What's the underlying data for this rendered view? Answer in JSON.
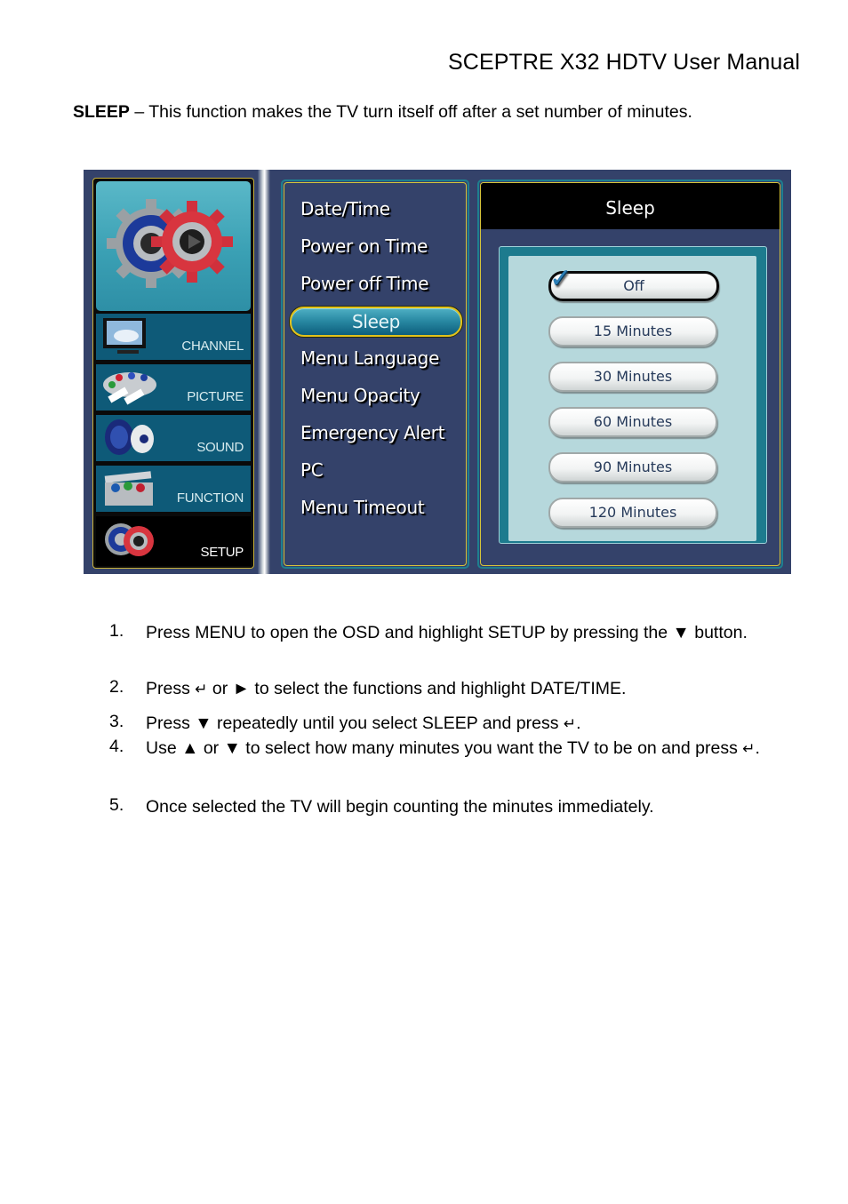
{
  "header": {
    "title": "SCEPTRE X32 HDTV User Manual"
  },
  "intro": {
    "term": "SLEEP",
    "text": " – This function makes the TV turn itself off after a set number of minutes."
  },
  "osd": {
    "nav": {
      "items": [
        {
          "label": "CHANNEL",
          "icon": "tv-icon",
          "active": false
        },
        {
          "label": "PICTURE",
          "icon": "palette-icon",
          "active": false
        },
        {
          "label": "SOUND",
          "icon": "speaker-icon",
          "active": false
        },
        {
          "label": "FUNCTION",
          "icon": "toolbox-icon",
          "active": false
        },
        {
          "label": "SETUP",
          "icon": "gears-icon",
          "active": true
        }
      ]
    },
    "menu": {
      "items": [
        {
          "label": "Date/Time"
        },
        {
          "label": "Power on Time"
        },
        {
          "label": "Power off Time"
        },
        {
          "label": "Sleep",
          "selected": true
        },
        {
          "label": "Menu Language"
        },
        {
          "label": "Menu Opacity"
        },
        {
          "label": "Emergency Alert"
        },
        {
          "label": "PC"
        },
        {
          "label": "Menu Timeout"
        }
      ]
    },
    "panel": {
      "title": "Sleep",
      "check_glyph": "✓",
      "options": [
        {
          "label": "Off",
          "selected": true
        },
        {
          "label": "15 Minutes"
        },
        {
          "label": "30 Minutes"
        },
        {
          "label": "60 Minutes"
        },
        {
          "label": "90 Minutes"
        },
        {
          "label": "120 Minutes"
        }
      ]
    }
  },
  "steps": [
    {
      "num": "1.",
      "parts": [
        "Press MENU to open the OSD and highlight SETUP by pressing the ▼ button."
      ]
    },
    {
      "num": "2.",
      "parts": [
        "Press ",
        "↵",
        " or ► to select the functions and highlight DATE/TIME."
      ]
    },
    {
      "num": "3.",
      "parts": [
        "Press ▼ repeatedly until you select SLEEP and press ",
        "↵",
        "."
      ]
    },
    {
      "num": "4.",
      "parts": [
        "Use ▲ or ▼ to select how many minutes you want the TV to be on and press ",
        "↵",
        "."
      ]
    },
    {
      "num": "5.",
      "parts": [
        "Once selected the TV will begin counting the minutes immediately."
      ]
    }
  ]
}
